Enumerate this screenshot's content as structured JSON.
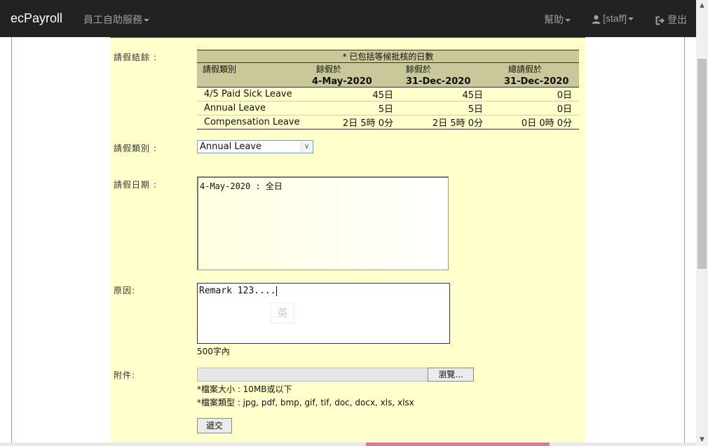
{
  "navbar": {
    "brand": "ecPayroll",
    "self_service_label": "員工自助服務",
    "help_label": "幫助",
    "user_label": "[staff]",
    "logout_label": "登出"
  },
  "form": {
    "summary_label": "請假結餘 :",
    "summary": {
      "note": "* 已包括等候批核的日數",
      "col_type": "請假類別",
      "col_balance_on": "餘假於",
      "col_balance_on_2": "餘假於",
      "col_total_on": "總請假於",
      "date1": "4-May-2020",
      "date2": "31-Dec-2020",
      "date3": "31-Dec-2020",
      "rows": [
        {
          "type": "4/5 Paid Sick Leave",
          "a": "45日",
          "b": "45日",
          "c": "0日"
        },
        {
          "type": "Annual Leave",
          "a": "5日",
          "b": "5日",
          "c": "0日"
        },
        {
          "type": "Compensation Leave",
          "a": "2日 5時 0分",
          "b": "2日 5時 0分",
          "c": "0日 0時 0分"
        }
      ]
    },
    "leave_type_label": "請假類別 :",
    "leave_type_value": "Annual Leave",
    "leave_date_label": "請假日期 :",
    "leave_date_value": "4-May-2020 : 全日",
    "reason_label": "原因:",
    "reason_value": "Remark 123....",
    "ime_indicator": "英",
    "reason_hint": "500字內",
    "attachment_label": "附件:",
    "browse_label": "瀏覽...",
    "file_size_note": "*檔案大小 : 10MB或以下",
    "file_type_note": "*檔案類型 : jpg, pdf, bmp, gif, tif, doc, docx, xls, xlsx",
    "submit_label": "遞交"
  }
}
